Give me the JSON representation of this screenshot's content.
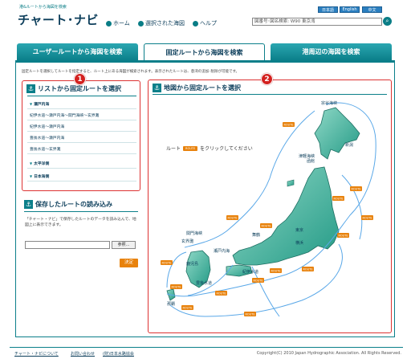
{
  "header": {
    "logo_sub": "港&ルートから海図を検索",
    "logo_main": "チャート･ナビ",
    "nav": [
      "ホーム",
      "選択された海図",
      "ヘルプ"
    ],
    "lang": [
      "日本語",
      "English",
      "中文"
    ],
    "search_placeholder": "図番号･図名検索: W90 東京湾",
    "search_icon": "search-icon"
  },
  "tabs": [
    "ユーザールートから海図を検索",
    "固定ルートから海図を検索",
    "港周辺の海図を検索"
  ],
  "description": "固定ルートを選択してルートを指定すると、ルート上にある海図が検索されます。表示されたルートは、意湾の追加･削除が可能です。",
  "list_panel": {
    "title": "リストから固定ルートを選択",
    "badge": "1",
    "rows": [
      {
        "label": "瀬戸内海",
        "category": true
      },
      {
        "label": "紀伊水道～瀬戸内海～関門海峡～玄界灘",
        "category": false
      },
      {
        "label": "紀伊水道～瀬戸内海",
        "category": false
      },
      {
        "label": "豊後水道～瀬戸内海",
        "category": false
      },
      {
        "label": "豊後水道～玄界灘",
        "category": false
      },
      {
        "label": "太平洋側",
        "category": true
      },
      {
        "label": "日本海側",
        "category": true
      }
    ]
  },
  "saved_panel": {
    "title": "保存したルートの読み込み",
    "description": "「チャート・ナビ」で保存したルートのデータを読み込んで、地図上に表示できます。",
    "browse_label": "参照...",
    "decide_label": "決定"
  },
  "map_panel": {
    "title": "地図から固定ルートを選択",
    "badge": "2",
    "hint_prefix": "ルート",
    "hint_chip": "ROUTE",
    "hint_suffix": "をクリックしてください",
    "labels": [
      "宗谷海峡",
      "函館",
      "津軽海峡",
      "新潟",
      "東京",
      "横浜",
      "舞鶴",
      "関門海峡",
      "玄界灘",
      "瀬戸内海",
      "豊後水道",
      "紀伊水道",
      "鹿児島",
      "那覇",
      "ROUTE"
    ]
  },
  "footer": {
    "links": [
      "チャート・ナビについて",
      "お問い合わせ",
      "(財)日本水路協会"
    ],
    "copyright": "Copyright(C) 2010 Japan Hydrographic Association. All Rights Reserved."
  },
  "colors": {
    "accent": "#0b7f8a",
    "highlight": "#d3211f",
    "route": "#e8820c",
    "land": "#3fb8a2"
  }
}
